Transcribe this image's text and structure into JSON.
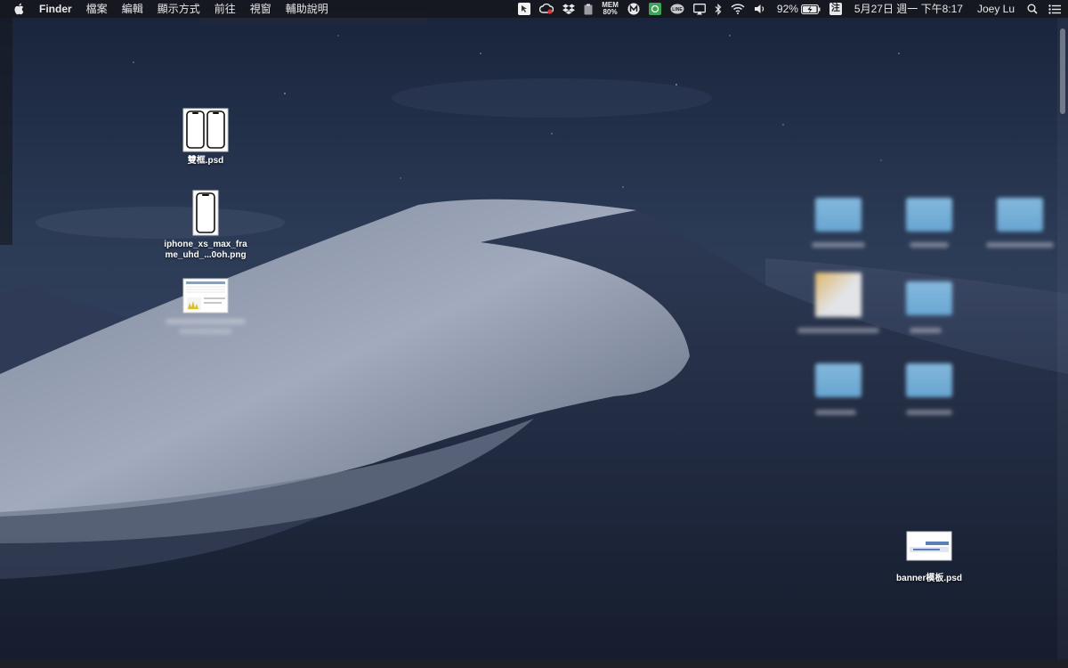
{
  "menubar": {
    "app_name": "Finder",
    "menus": [
      "檔案",
      "編輯",
      "顯示方式",
      "前往",
      "視窗",
      "輔助說明"
    ],
    "status": {
      "mem_label": "MEM",
      "mem_value": "80%",
      "battery_percent": "92%",
      "ime_label": "注",
      "datetime": "5月27日 週一 下午8:17",
      "user": "Joey Lu"
    }
  },
  "desktop": {
    "icons": [
      {
        "name": "雙框.psd",
        "icon": "psd-double-phone-frame-icon"
      },
      {
        "name_line1": "iphone_xs_max_fra",
        "name_line2": "me_uhd_...0oh.png",
        "icon": "phone-frame-png-icon"
      },
      {
        "name": "",
        "icon": "spreadsheet-thumbnail-icon"
      },
      {
        "name": "banner模板.psd",
        "icon": "banner-psd-icon"
      }
    ]
  },
  "colors": {
    "menubar_bg": "#16181e",
    "folder_blue": "#7ab9e4",
    "sky_top": "#1c2638",
    "dune_light": "#9aa3b5"
  }
}
